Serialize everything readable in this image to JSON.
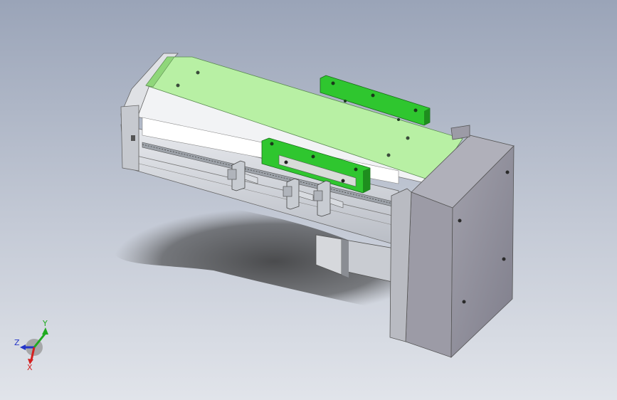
{
  "viewport": {
    "background_top": "#9aa4b8",
    "background_bottom": "#e1e4ea"
  },
  "model": {
    "accent_color": "#2fc62f",
    "belt_color": "#b8f0a4",
    "body_color": "#cfd3d9",
    "motor_block_color": "#8f8f9b"
  },
  "triad": {
    "x_label": "X",
    "y_label": "Y",
    "z_label": "Z",
    "x_color": "#d42020",
    "y_color": "#1faa1f",
    "z_color": "#2435c8"
  }
}
